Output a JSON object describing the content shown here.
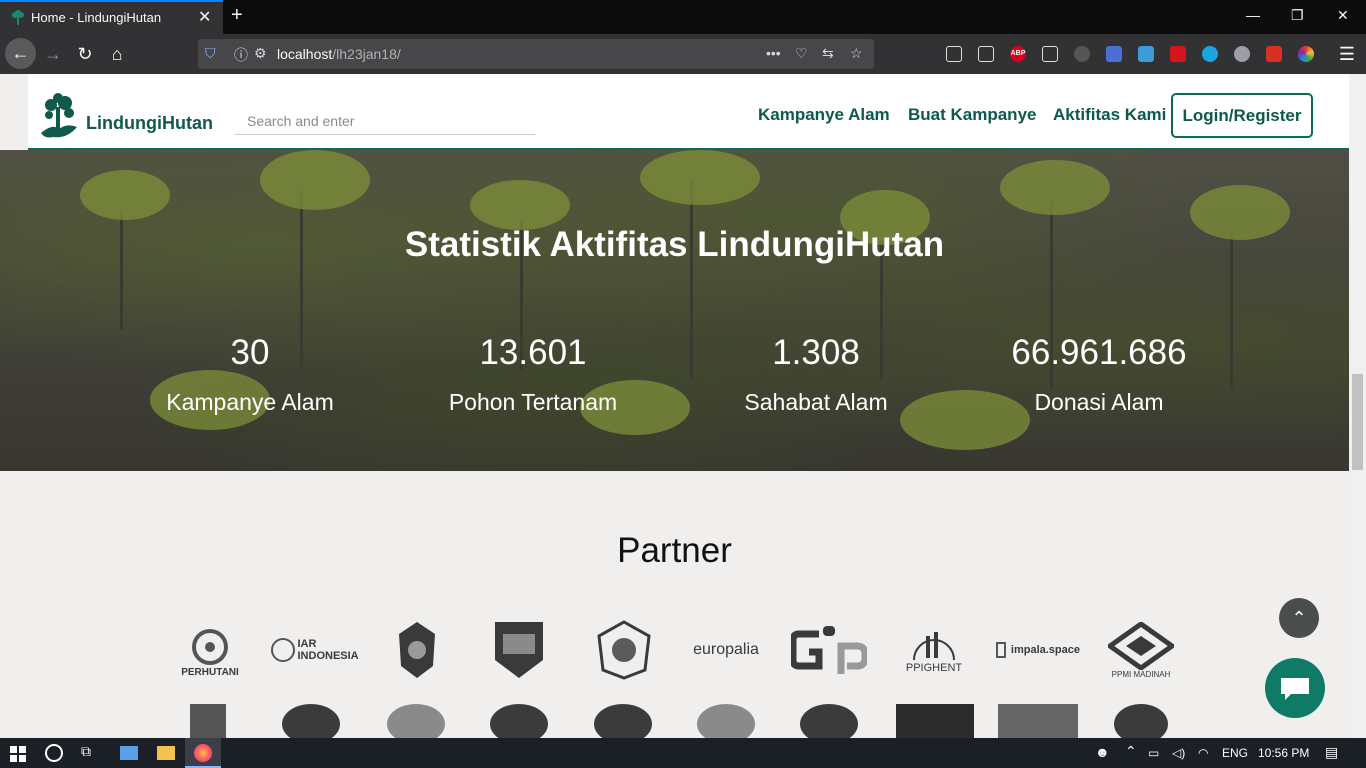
{
  "browser": {
    "tab_title": "Home - LindungiHutan",
    "url_host": "localhost",
    "url_path": "/lh23jan18/",
    "new_tab_symbol": "+",
    "close_symbol": "✕",
    "abp_label": "ABP"
  },
  "header": {
    "logo_text": "LindungiHutan",
    "search_placeholder": "Search and enter",
    "nav": [
      "Kampanye Alam",
      "Buat Kampanye",
      "Aktifitas Kami"
    ],
    "login_label": "Login/Register"
  },
  "stats": {
    "title": "Statistik Aktifitas LindungiHutan",
    "items": [
      {
        "value": "30",
        "label": "Kampanye Alam"
      },
      {
        "value": "13.601",
        "label": "Pohon Tertanam"
      },
      {
        "value": "1.308",
        "label": "Sahabat Alam"
      },
      {
        "value": "66.961.686",
        "label": "Donasi Alam"
      }
    ]
  },
  "partner": {
    "title": "Partner",
    "logos": [
      "PERHUTANI",
      "IAR INDONESIA",
      "Kabupaten crest",
      "Kota crest",
      "Provinsi crest",
      "europalia",
      "Gp logo",
      "PPIGHENT",
      "impala.space",
      "PPMI MADINAH"
    ]
  },
  "taskbar": {
    "lang": "ENG",
    "time": "10:56 PM"
  },
  "colors": {
    "brand": "#0d6b55",
    "chat": "#0f7b67"
  }
}
